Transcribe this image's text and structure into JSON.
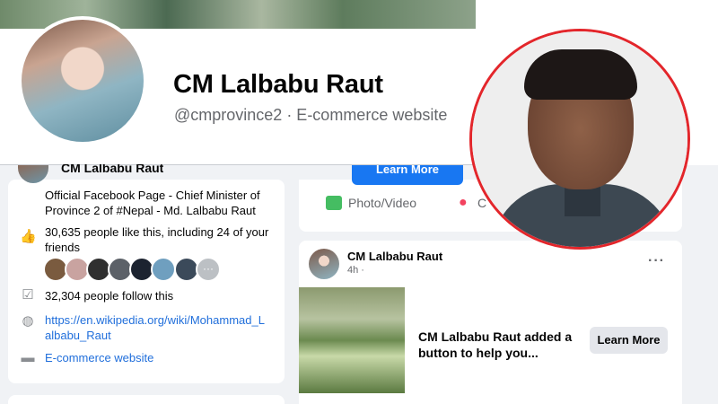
{
  "profile": {
    "name": "CM Lalbabu Raut",
    "handle_line": "@cmprovince2 · E-commerce website"
  },
  "intro": {
    "mini_name": "CM Lalbabu Raut",
    "description": "Official Facebook Page - Chief Minister of Province 2 of #Nepal - Md. Lalbabu Raut",
    "likes": "30,635 people like this, including 24 of your friends",
    "follows": "32,304 people follow this",
    "website": "https://en.wikipedia.org/wiki/Mohammad_Lalbabu_Raut",
    "category": "E-commerce website"
  },
  "composer": {
    "learn_more_top": "Learn More",
    "photo_video": "Photo/Video",
    "checkin_partial": "C"
  },
  "post": {
    "author": "CM Lalbabu Raut",
    "time": "4h ·",
    "text": "CM Lalbabu Raut added a button to help you...",
    "button": "Learn More",
    "more": "···"
  },
  "colors": {
    "accent": "#1877f2",
    "link": "#216fdb",
    "portrait_ring": "#e3262b"
  },
  "icons": {
    "like": "thumbs-up-icon",
    "follow": "check-icon",
    "globe": "globe-icon",
    "category": "tag-icon",
    "photo": "photo-icon",
    "pin": "location-pin-icon"
  }
}
